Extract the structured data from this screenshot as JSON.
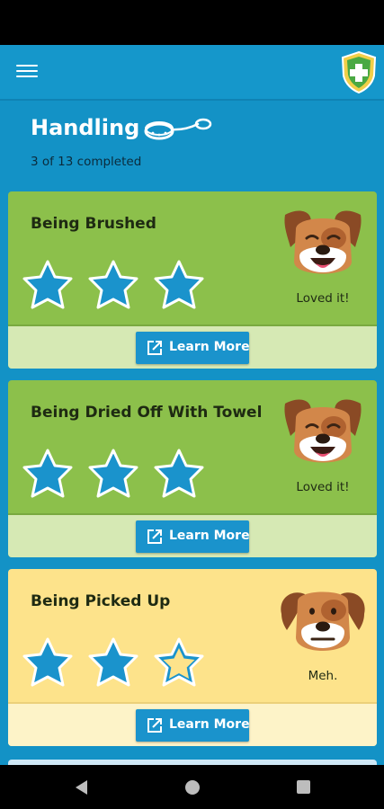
{
  "header": {
    "title": "Handling",
    "progress_text": "3 of 13 completed"
  },
  "appbar": {
    "menu_icon": "hamburger-menu-icon",
    "logo_icon": "shield-cross-icon"
  },
  "colors": {
    "primary": "#1392c6",
    "card_green": "#8cc04b",
    "card_yellow": "#fde38b",
    "star_fill": "#1a93cc"
  },
  "cards": [
    {
      "title": "Being Brushed",
      "rating": 3,
      "max_rating": 3,
      "reaction": "Loved it!",
      "mood": "happy",
      "button_label": "Learn More"
    },
    {
      "title": "Being Dried Off With Towel",
      "rating": 3,
      "max_rating": 3,
      "reaction": "Loved it!",
      "mood": "happy",
      "button_label": "Learn More"
    },
    {
      "title": "Being Picked Up",
      "rating": 2,
      "max_rating": 3,
      "reaction": "Meh.",
      "mood": "neutral",
      "button_label": "Learn More"
    }
  ]
}
